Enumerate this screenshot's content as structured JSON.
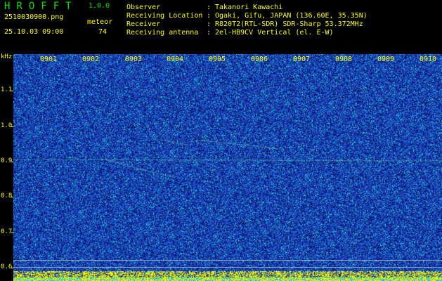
{
  "header": {
    "app_title": "HROFFT",
    "version": "1.0.0",
    "filename": "2510030900.png",
    "timestamp": "25.10.03 09:00",
    "meteor_label": "meteor",
    "meteor_count": "74"
  },
  "info": [
    {
      "key": "Observer",
      "value": "Takanori Kawachi"
    },
    {
      "key": "Receiving Location",
      "value": "Ogaki, Gifu, JAPAN (136.60E, 35.35N)"
    },
    {
      "key": "Receiver",
      "value": "R820T2(RTL-SDR) SDR-Sharp 53.372MHz"
    },
    {
      "key": "Receiving antenna",
      "value": "2el-HB9CV Vertical (el. E-W)"
    }
  ],
  "separator": ":",
  "y_axis": {
    "unit": "kHz",
    "ticks": [
      "1.1",
      "1.0",
      "0.9",
      "0.8",
      "0.7",
      "0.6"
    ],
    "range_khz": [
      0.58,
      1.18
    ]
  },
  "x_axis": {
    "ticks": [
      "0901",
      "0902",
      "0903",
      "0904",
      "0905",
      "0906",
      "0907",
      "0908",
      "0909",
      "0910"
    ]
  },
  "colors": {
    "background": "#000000",
    "label": "#ffff00",
    "title": "#00e000",
    "spectrum_base": "#1a2fa8",
    "noise_hot": "#00c8ff",
    "trace": "#7fff7f"
  }
}
